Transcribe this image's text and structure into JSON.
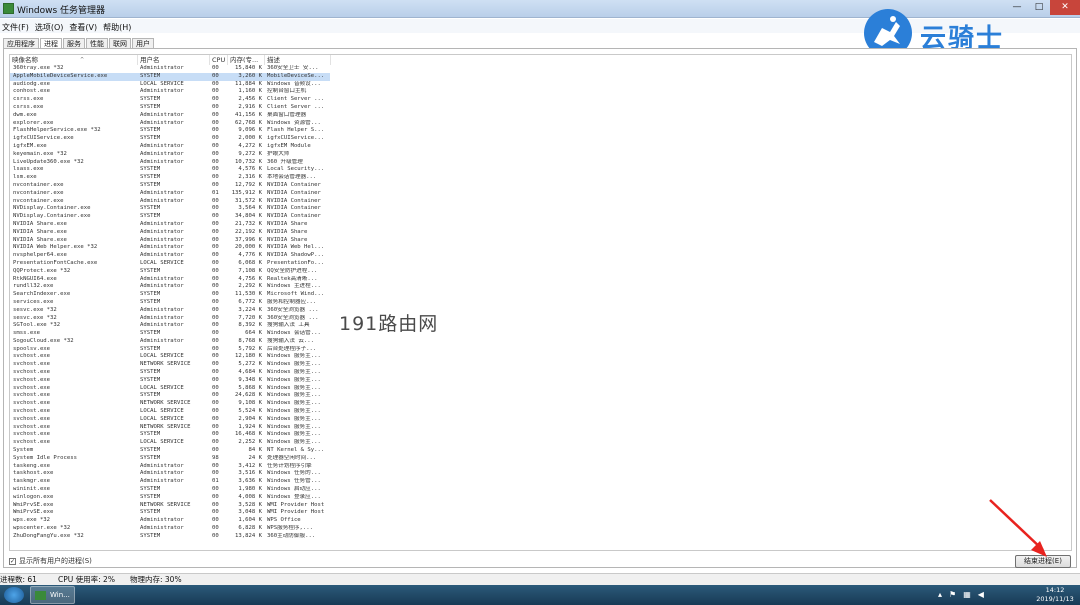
{
  "window": {
    "title": "Windows 任务管理器",
    "buttons": {
      "minimize": "—",
      "maximize": "□",
      "close": "✕"
    }
  },
  "menu": [
    "文件(F)",
    "选项(O)",
    "查看(V)",
    "帮助(H)"
  ],
  "tabs": [
    {
      "label": "应用程序",
      "active": false
    },
    {
      "label": "进程",
      "active": true
    },
    {
      "label": "服务",
      "active": false
    },
    {
      "label": "性能",
      "active": false
    },
    {
      "label": "联网",
      "active": false
    },
    {
      "label": "用户",
      "active": false
    }
  ],
  "columns": [
    "映像名称",
    "用户名",
    "CPU",
    "内存(专...",
    "描述"
  ],
  "sort_indicator": "^",
  "rows": [
    [
      "360tray.exe *32",
      "Administrator",
      "00",
      "15,840 K",
      "360安全卫士 安..."
    ],
    [
      "AppleMobileDeviceService.exe",
      "SYSTEM",
      "00",
      "3,260 K",
      "MobileDeviceSe..."
    ],
    [
      "audiodg.exe",
      "LOCAL SERVICE",
      "00",
      "11,884 K",
      "Windows 音频设..."
    ],
    [
      "conhost.exe",
      "Administrator",
      "00",
      "1,160 K",
      "控制台窗口主机"
    ],
    [
      "csrss.exe",
      "SYSTEM",
      "00",
      "2,456 K",
      "Client Server ..."
    ],
    [
      "csrss.exe",
      "SYSTEM",
      "00",
      "2,916 K",
      "Client Server ..."
    ],
    [
      "dwm.exe",
      "Administrator",
      "00",
      "41,156 K",
      "桌面窗口管理器"
    ],
    [
      "explorer.exe",
      "Administrator",
      "00",
      "62,768 K",
      "Windows 资源管..."
    ],
    [
      "FlashHelperService.exe *32",
      "SYSTEM",
      "00",
      "9,096 K",
      "Flash Helper S..."
    ],
    [
      "igfxCUIService.exe",
      "SYSTEM",
      "00",
      "2,000 K",
      "igfxCUIService..."
    ],
    [
      "igfxEM.exe",
      "Administrator",
      "00",
      "4,272 K",
      "igfxEM Module"
    ],
    [
      "keyemain.exe *32",
      "Administrator",
      "00",
      "9,272 K",
      "护眼大师"
    ],
    [
      "LiveUpdate360.exe *32",
      "Administrator",
      "00",
      "10,732 K",
      "360 升级管理"
    ],
    [
      "lsass.exe",
      "SYSTEM",
      "00",
      "4,576 K",
      "Local Security..."
    ],
    [
      "lsm.exe",
      "SYSTEM",
      "00",
      "2,316 K",
      "本地会话管理器..."
    ],
    [
      "nvcontainer.exe",
      "SYSTEM",
      "00",
      "12,792 K",
      "NVIDIA Container"
    ],
    [
      "nvcontainer.exe",
      "Administrator",
      "01",
      "135,912 K",
      "NVIDIA Container"
    ],
    [
      "nvcontainer.exe",
      "Administrator",
      "00",
      "31,572 K",
      "NVIDIA Container"
    ],
    [
      "NVDisplay.Container.exe",
      "SYSTEM",
      "00",
      "3,564 K",
      "NVIDIA Container"
    ],
    [
      "NVDisplay.Container.exe",
      "SYSTEM",
      "00",
      "34,804 K",
      "NVIDIA Container"
    ],
    [
      "NVIDIA Share.exe",
      "Administrator",
      "00",
      "21,732 K",
      "NVIDIA Share"
    ],
    [
      "NVIDIA Share.exe",
      "Administrator",
      "00",
      "22,192 K",
      "NVIDIA Share"
    ],
    [
      "NVIDIA Share.exe",
      "Administrator",
      "00",
      "37,996 K",
      "NVIDIA Share"
    ],
    [
      "NVIDIA Web Helper.exe *32",
      "Administrator",
      "00",
      "20,000 K",
      "NVIDIA Web Hel..."
    ],
    [
      "nvsphelper64.exe",
      "Administrator",
      "00",
      "4,776 K",
      "NVIDIA ShadowP..."
    ],
    [
      "PresentationFontCache.exe",
      "LOCAL SERVICE",
      "00",
      "6,068 K",
      "PresentationFo..."
    ],
    [
      "QQProtect.exe *32",
      "SYSTEM",
      "00",
      "7,108 K",
      "QQ安全防护进程..."
    ],
    [
      "RtkNGUI64.exe",
      "Administrator",
      "00",
      "4,756 K",
      "Realtek高清晰..."
    ],
    [
      "rundll32.exe",
      "Administrator",
      "00",
      "2,292 K",
      "Windows 主进程..."
    ],
    [
      "SearchIndexer.exe",
      "SYSTEM",
      "00",
      "11,530 K",
      "Microsoft Wind..."
    ],
    [
      "services.exe",
      "SYSTEM",
      "00",
      "6,772 K",
      "服务和控制器应..."
    ],
    [
      "sesvc.exe *32",
      "Administrator",
      "00",
      "3,224 K",
      "360安全浏览器 ..."
    ],
    [
      "sesvc.exe *32",
      "Administrator",
      "00",
      "7,720 K",
      "360安全浏览器 ..."
    ],
    [
      "SGTool.exe *32",
      "Administrator",
      "00",
      "8,392 K",
      "搜狗输入法 工具"
    ],
    [
      "smss.exe",
      "SYSTEM",
      "00",
      "664 K",
      "Windows 会话管..."
    ],
    [
      "SogouCloud.exe *32",
      "Administrator",
      "00",
      "8,768 K",
      "搜狗输入法 云..."
    ],
    [
      "spoolsv.exe",
      "SYSTEM",
      "00",
      "5,792 K",
      "后台处理程序子..."
    ],
    [
      "svchost.exe",
      "LOCAL SERVICE",
      "00",
      "12,180 K",
      "Windows 服务主..."
    ],
    [
      "svchost.exe",
      "NETWORK SERVICE",
      "00",
      "5,272 K",
      "Windows 服务主..."
    ],
    [
      "svchost.exe",
      "SYSTEM",
      "00",
      "4,684 K",
      "Windows 服务主..."
    ],
    [
      "svchost.exe",
      "SYSTEM",
      "00",
      "9,348 K",
      "Windows 服务主..."
    ],
    [
      "svchost.exe",
      "LOCAL SERVICE",
      "00",
      "5,868 K",
      "Windows 服务主..."
    ],
    [
      "svchost.exe",
      "SYSTEM",
      "00",
      "24,628 K",
      "Windows 服务主..."
    ],
    [
      "svchost.exe",
      "NETWORK SERVICE",
      "00",
      "9,108 K",
      "Windows 服务主..."
    ],
    [
      "svchost.exe",
      "LOCAL SERVICE",
      "00",
      "5,524 K",
      "Windows 服务主..."
    ],
    [
      "svchost.exe",
      "LOCAL SERVICE",
      "00",
      "2,904 K",
      "Windows 服务主..."
    ],
    [
      "svchost.exe",
      "NETWORK SERVICE",
      "00",
      "1,924 K",
      "Windows 服务主..."
    ],
    [
      "svchost.exe",
      "SYSTEM",
      "00",
      "16,468 K",
      "Windows 服务主..."
    ],
    [
      "svchost.exe",
      "LOCAL SERVICE",
      "00",
      "2,252 K",
      "Windows 服务主..."
    ],
    [
      "System",
      "SYSTEM",
      "00",
      "84 K",
      "NT Kernel & Sy..."
    ],
    [
      "System Idle Process",
      "SYSTEM",
      "98",
      "24 K",
      "处理器空闲时间..."
    ],
    [
      "taskeng.exe",
      "Administrator",
      "00",
      "3,412 K",
      "任务计划程序引擎"
    ],
    [
      "taskhost.exe",
      "Administrator",
      "00",
      "3,516 K",
      "Windows 任务的..."
    ],
    [
      "taskmgr.exe",
      "Administrator",
      "01",
      "3,636 K",
      "Windows 任务管..."
    ],
    [
      "wininit.exe",
      "SYSTEM",
      "00",
      "1,980 K",
      "Windows 启动应..."
    ],
    [
      "winlogon.exe",
      "SYSTEM",
      "00",
      "4,008 K",
      "Windows 登录应..."
    ],
    [
      "WmiPrvSE.exe",
      "NETWORK SERVICE",
      "00",
      "3,528 K",
      "WMI Provider Host"
    ],
    [
      "WmiPrvSE.exe",
      "SYSTEM",
      "00",
      "3,048 K",
      "WMI Provider Host"
    ],
    [
      "wps.exe *32",
      "Administrator",
      "00",
      "1,604 K",
      "WPS Office"
    ],
    [
      "wpscenter.exe *32",
      "Administrator",
      "00",
      "6,828 K",
      "WPS服务程序,..."
    ],
    [
      "ZhuDongFangYu.exe *32",
      "SYSTEM",
      "00",
      "13,824 K",
      "360主动防御服..."
    ]
  ],
  "selected_row": 1,
  "show_all_label": "显示所有用户的进程(S)",
  "show_all_checked": true,
  "end_process_label": "结束进程(E)",
  "status": {
    "processes": "进程数: 61",
    "cpu": "CPU 使用率: 2%",
    "memory": "物理内存: 30%"
  },
  "watermark": "191路由网",
  "logo_text": "云骑士",
  "taskbar": {
    "item_label": "Win...",
    "time": "14:12",
    "date": "2019/11/13",
    "tray_icons": [
      "up-arrow-icon",
      "flag-icon",
      "network-icon",
      "volume-icon"
    ]
  },
  "colors": {
    "selection": "#c7ddf6",
    "accent": "#2b7fd8",
    "arrow": "#e8231f",
    "close_button": "#c8453b"
  }
}
